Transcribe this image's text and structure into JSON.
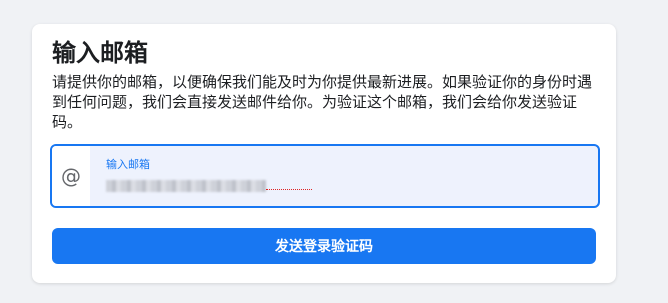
{
  "card": {
    "title": "输入邮箱",
    "description": "请提供你的邮箱，以便确保我们能及时为你提供最新进展。如果验证你的身份时遇到任何问题，我们会直接发送邮件给你。为验证这个邮箱，我们会给你发送验证码。"
  },
  "email_field": {
    "icon": "@",
    "label": "输入邮箱"
  },
  "send_button": {
    "label": "发送登录验证码"
  },
  "colors": {
    "accent": "#1877f2",
    "background": "#f0f2f5",
    "field_background": "#eef2fd"
  }
}
